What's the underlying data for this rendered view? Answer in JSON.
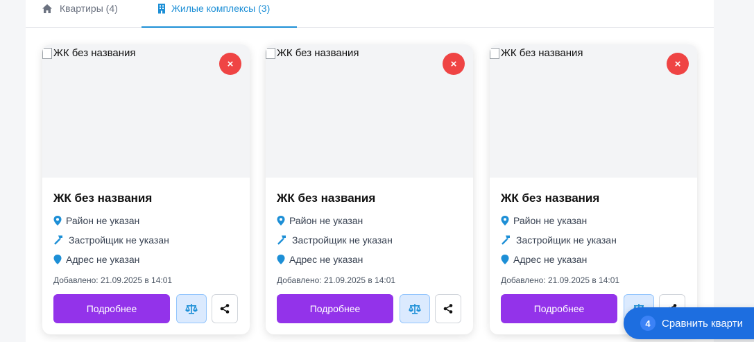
{
  "tabs": {
    "flats": "Квартиры (4)",
    "complexes": "Жилые комплексы (3)"
  },
  "cards": [
    {
      "img_alt": "ЖК без названия",
      "title": "ЖК без названия",
      "district": "Район не указан",
      "developer": "Застройщик не указан",
      "address": "Адрес не указан",
      "added": "Добавлено: 21.09.2025 в 14:01",
      "more_label": "Подробнее",
      "remove_label": "×"
    },
    {
      "img_alt": "ЖК без названия",
      "title": "ЖК без названия",
      "district": "Район не указан",
      "developer": "Застройщик не указан",
      "address": "Адрес не указан",
      "added": "Добавлено: 21.09.2025 в 14:01",
      "more_label": "Подробнее",
      "remove_label": "×"
    },
    {
      "img_alt": "ЖК без названия",
      "title": "ЖК без названия",
      "district": "Район не указан",
      "developer": "Застройщик не указан",
      "address": "Адрес не указан",
      "added": "Добавлено: 21.09.2025 в 14:01",
      "more_label": "Подробнее",
      "remove_label": "×"
    }
  ],
  "compare": {
    "count": "4",
    "label": "Сравнить кварти"
  },
  "colors": {
    "accent": "#1d8fd6",
    "primary_button": "#9333ea",
    "remove": "#ef4444",
    "compare_float": "#1d6ee0"
  },
  "icons": [
    "home-icon",
    "building-icon",
    "map-pin-icon",
    "hammer-icon",
    "location-icon",
    "scales-icon",
    "share-icon",
    "close-icon"
  ]
}
